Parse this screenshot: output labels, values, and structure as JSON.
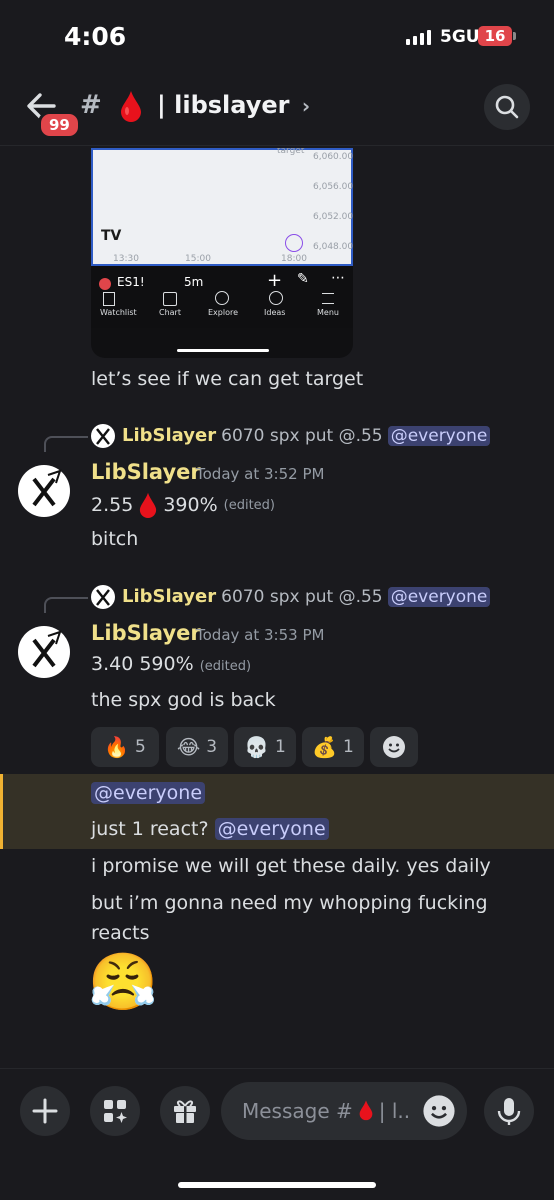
{
  "status": {
    "time": "4:06",
    "network": "5GUC",
    "battery": "16"
  },
  "header": {
    "unread_badge": "99",
    "hash": "#",
    "channel_name": "| libslayer",
    "chevron": "›"
  },
  "embed": {
    "chart_label_target": "target",
    "price_ticks": [
      "6,060.00",
      "6,056.00",
      "6,052.00",
      "6,048.00"
    ],
    "time_ticks": [
      "13:30",
      "15:00",
      "18:00"
    ],
    "symbol": "ES1!",
    "interval": "5m",
    "nav": [
      "Watchlist",
      "Chart",
      "Explore",
      "Ideas",
      "Menu"
    ]
  },
  "messages": {
    "caption": "let’s see if we can get target",
    "m1": {
      "reply_author": "LibSlayer",
      "reply_text": "6070 spx put @.55",
      "reply_mention": "@everyone",
      "author": "LibSlayer",
      "time": "Today at 3:52 PM",
      "line1_a": "2.55",
      "line1_b": "390%",
      "edited": "(edited)",
      "line2": "bitch"
    },
    "m2": {
      "reply_author": "LibSlayer",
      "reply_text": "6070 spx put @.55",
      "reply_mention": "@everyone",
      "author": "LibSlayer",
      "time": "Today at 3:53 PM",
      "line1": "3.40 590%",
      "edited": "(edited)",
      "line2": "the spx god is back"
    },
    "reactions": [
      {
        "emoji": "🔥",
        "count": "5"
      },
      {
        "emoji": "😂",
        "count": "3"
      },
      {
        "emoji": "💀",
        "count": "1"
      },
      {
        "emoji": "💰",
        "count": "1"
      }
    ],
    "mention_line": "@everyone",
    "just_react": "just 1 react?",
    "just_react_mention": "@everyone",
    "promise": "i promise we will get these daily. yes daily",
    "reacts_1": "but i’m gonna need my whopping fucking",
    "reacts_2": "reacts",
    "big_emoji": "😤"
  },
  "composer": {
    "placeholder_a": "Message #",
    "placeholder_b": "| l.."
  },
  "colors": {
    "accent_name": "#f0e08a",
    "mention_bg": "#3c4270",
    "highlight_border": "#f0b232",
    "badge": "#e0454a"
  }
}
